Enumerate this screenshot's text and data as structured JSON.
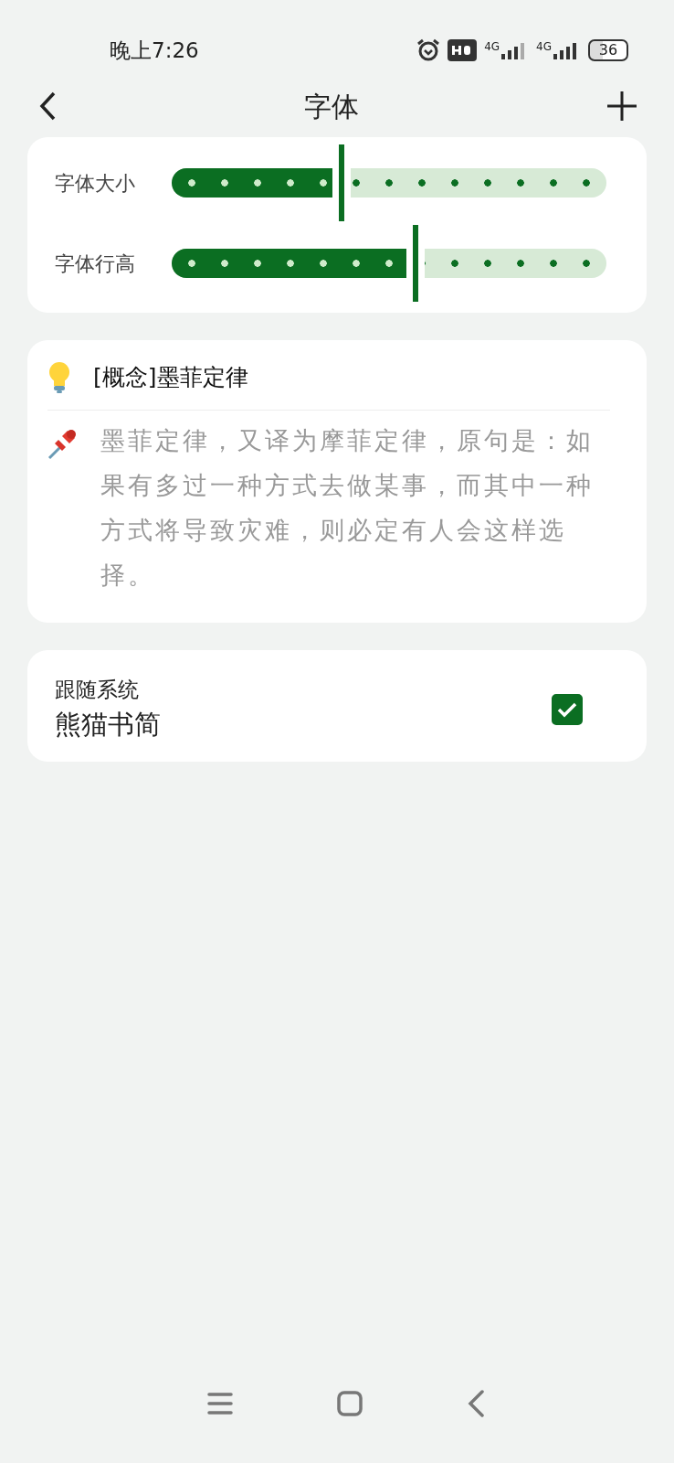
{
  "status_bar": {
    "time": "晚上7:26",
    "network_1": "4G",
    "network_2": "4G",
    "battery": "36"
  },
  "header": {
    "title": "字体"
  },
  "sliders": [
    {
      "label": "字体大小",
      "level": 0.39
    },
    {
      "label": "字体行高",
      "level": 0.56
    }
  ],
  "preview": {
    "title": "[概念]墨菲定律",
    "body": "墨菲定律，又译为摩菲定律，原句是：如果有多过一种方式去做某事，而其中一种方式将导致灾难，则必定有人会这样选择。"
  },
  "font_option": {
    "caption": "跟随系统",
    "name": "熊猫书简",
    "checked": true
  }
}
